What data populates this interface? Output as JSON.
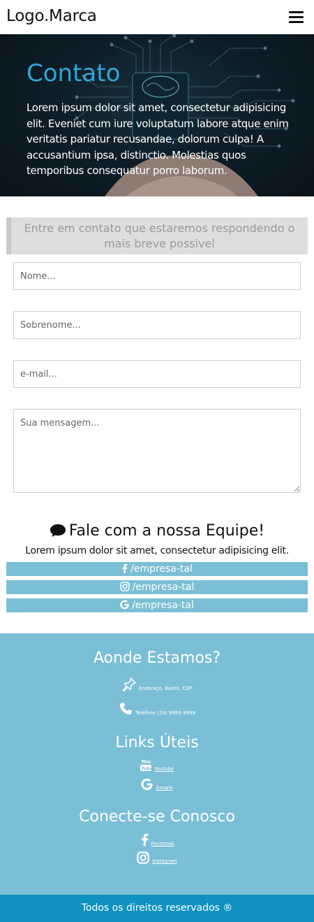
{
  "navbar": {
    "brand": "Logo.Marca",
    "menu_icon": "hamburger-icon"
  },
  "hero": {
    "title": "Contato",
    "text": "Lorem ipsum dolor sit amet, consectetur adipisicing elit. Eveniet cum iure voluptatum labore atque enim veritatis pariatur recusandae, dolorum culpa! A accusantium ipsa, distinctio. Molestias quos temporibus consequatur porro laborum."
  },
  "contact": {
    "notice": "Entre em contato que estaremos respondendo o mais breve possivel",
    "first_name_placeholder": "Nome...",
    "last_name_placeholder": "Sobrenome...",
    "email_placeholder": "e-mail...",
    "message_placeholder": "Sua mensagem..."
  },
  "team": {
    "title": "Fale com a nossa Equipe!",
    "title_icon": "chat-bubble-icon",
    "text": "Lorem ipsum dolor sit amet, consectetur adipisicing elit.",
    "links": [
      {
        "icon": "facebook-icon",
        "label": "/empresa-tal"
      },
      {
        "icon": "instagram-icon",
        "label": "/empresa-tal"
      },
      {
        "icon": "google-icon",
        "label": "/empresa-tal"
      }
    ]
  },
  "footer": {
    "location_title": "Aonde Estamos?",
    "address": "Endereço, Bairro, CEP",
    "phone": "Telefone (19) 9999-9999",
    "links_title": "Links Úteis",
    "links": [
      {
        "icon": "youtube-icon",
        "label": "Youtube"
      },
      {
        "icon": "google-icon",
        "label": "Google"
      }
    ],
    "connect_title": "Conecte-se Conosco",
    "connect": [
      {
        "icon": "facebook-icon",
        "label": "Facebook"
      },
      {
        "icon": "instagram-icon",
        "label": "Instagram"
      }
    ],
    "copyright": "Todos os direitos reservados ®"
  },
  "colors": {
    "accent": "#2fa8d6",
    "social_bar": "#7bbfd6",
    "footer_bg": "#7bbfd6",
    "copyright_bg": "#0f92c0",
    "notice_bg": "#dedede"
  }
}
